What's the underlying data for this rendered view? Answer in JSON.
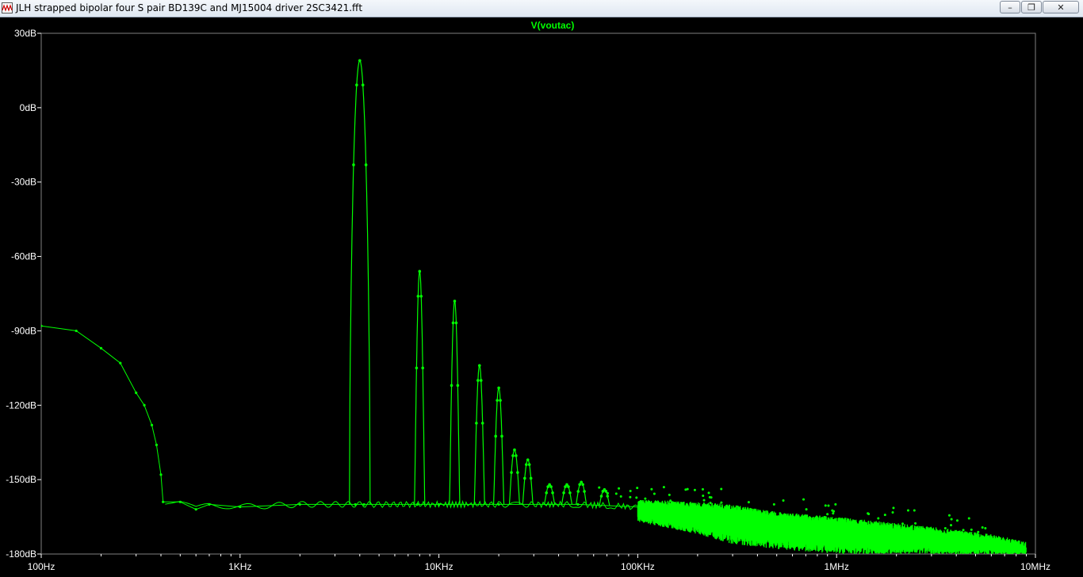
{
  "window": {
    "title": "JLH strapped bipolar four S pair BD139C and  MJ15004 driver 2SC3421.fft",
    "min_glyph": "–",
    "max_glyph": "❐",
    "close_glyph": "✕"
  },
  "colors": {
    "trace": "#00ff00",
    "axis_text": "#ffffff",
    "title_text": "#00ff00",
    "border": "#808080",
    "background": "#000000"
  },
  "chart_data": {
    "type": "line",
    "title": "V(voutac)",
    "x_scale": "log",
    "xlim": [
      100,
      10000000
    ],
    "ylim": [
      -180,
      30
    ],
    "x_ticks": [
      100,
      1000,
      10000,
      100000,
      1000000,
      10000000
    ],
    "x_tick_labels": [
      "100Hz",
      "1KHz",
      "10KHz",
      "100KHz",
      "1MHz",
      "10MHz"
    ],
    "y_ticks": [
      30,
      0,
      -30,
      -60,
      -90,
      -120,
      -150,
      -180
    ],
    "y_tick_labels": [
      "30dB",
      "0dB",
      "-30dB",
      "-60dB",
      "-90dB",
      "-120dB",
      "-150dB",
      "-180dB"
    ],
    "grid": false,
    "series": [
      {
        "name": "V(voutac)",
        "baseline": [
          [
            100,
            -88
          ],
          [
            150,
            -90
          ],
          [
            200,
            -97
          ],
          [
            250,
            -103
          ],
          [
            300,
            -115
          ],
          [
            330,
            -120
          ],
          [
            360,
            -128
          ],
          [
            380,
            -136
          ],
          [
            400,
            -148
          ],
          [
            410,
            -159
          ],
          [
            500,
            -159
          ],
          [
            600,
            -162
          ],
          [
            700,
            -160
          ],
          [
            1000,
            -161
          ],
          [
            2000,
            -160
          ],
          [
            3800,
            -160
          ],
          [
            4200,
            -160
          ],
          [
            7800,
            -160
          ],
          [
            10000,
            -160
          ],
          [
            20000,
            -160
          ],
          [
            50000,
            -160
          ],
          [
            100000,
            -161
          ],
          [
            200000,
            -162
          ],
          [
            400000,
            -165
          ],
          [
            1000000,
            -169
          ],
          [
            3000000,
            -173
          ],
          [
            6000000,
            -175
          ],
          [
            8500000,
            -178
          ],
          [
            9000000,
            -180
          ]
        ],
        "peaks": [
          {
            "f": 4000,
            "db": 19
          },
          {
            "f": 8000,
            "db": -66
          },
          {
            "f": 12000,
            "db": -78
          },
          {
            "f": 16000,
            "db": -104
          },
          {
            "f": 20000,
            "db": -113
          },
          {
            "f": 24000,
            "db": -138
          },
          {
            "f": 28000,
            "db": -142
          },
          {
            "f": 36000,
            "db": -152
          },
          {
            "f": 44000,
            "db": -152
          },
          {
            "f": 52000,
            "db": -151
          },
          {
            "f": 68000,
            "db": -154
          }
        ],
        "noise_floor_band": [
          [
            100000,
            -161,
            -167
          ],
          [
            200000,
            -162,
            -172
          ],
          [
            300000,
            -163,
            -176
          ],
          [
            500000,
            -166,
            -178
          ],
          [
            1000000,
            -168,
            -180
          ],
          [
            3000000,
            -172,
            -180
          ],
          [
            6000000,
            -175,
            -180
          ],
          [
            9000000,
            -178,
            -180
          ]
        ]
      }
    ]
  }
}
